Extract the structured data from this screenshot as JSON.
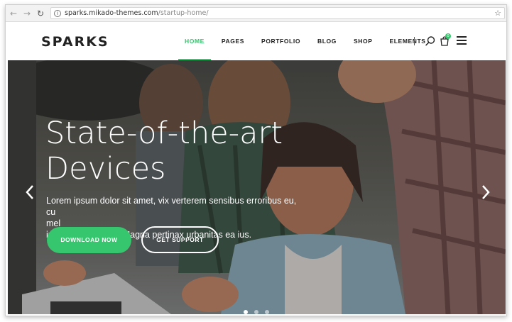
{
  "browser": {
    "url_host": "sparks.mikado-themes.com",
    "url_path": "/startup-home/"
  },
  "site": {
    "logo": "SPARKS",
    "menu": [
      {
        "label": "HOME",
        "active": true
      },
      {
        "label": "PAGES",
        "active": false
      },
      {
        "label": "PORTFOLIO",
        "active": false
      },
      {
        "label": "BLOG",
        "active": false
      },
      {
        "label": "SHOP",
        "active": false
      },
      {
        "label": "ELEMENTS",
        "active": false
      }
    ],
    "cart_count": "0",
    "icons": [
      "search-icon",
      "cart-icon",
      "hamburger-menu-icon"
    ]
  },
  "hero": {
    "title_line1": "State-of-the-art",
    "title_line2": "Devices",
    "text_line1": "Lorem ipsum dolor sit amet, vix verterem sensibus erroribus eu, cu",
    "text_line2": "mel",
    "text_line3": "iusto iudico labore. Magna pertinax urbanitas ea ius.",
    "primary_button": "DOWNLOAD NOW",
    "secondary_button": "GET SUPPORT",
    "slide_count": 3,
    "active_slide": 1
  },
  "colors": {
    "accent": "#36c66e",
    "text_dark": "#222222",
    "hero_text": "#ffffff"
  }
}
